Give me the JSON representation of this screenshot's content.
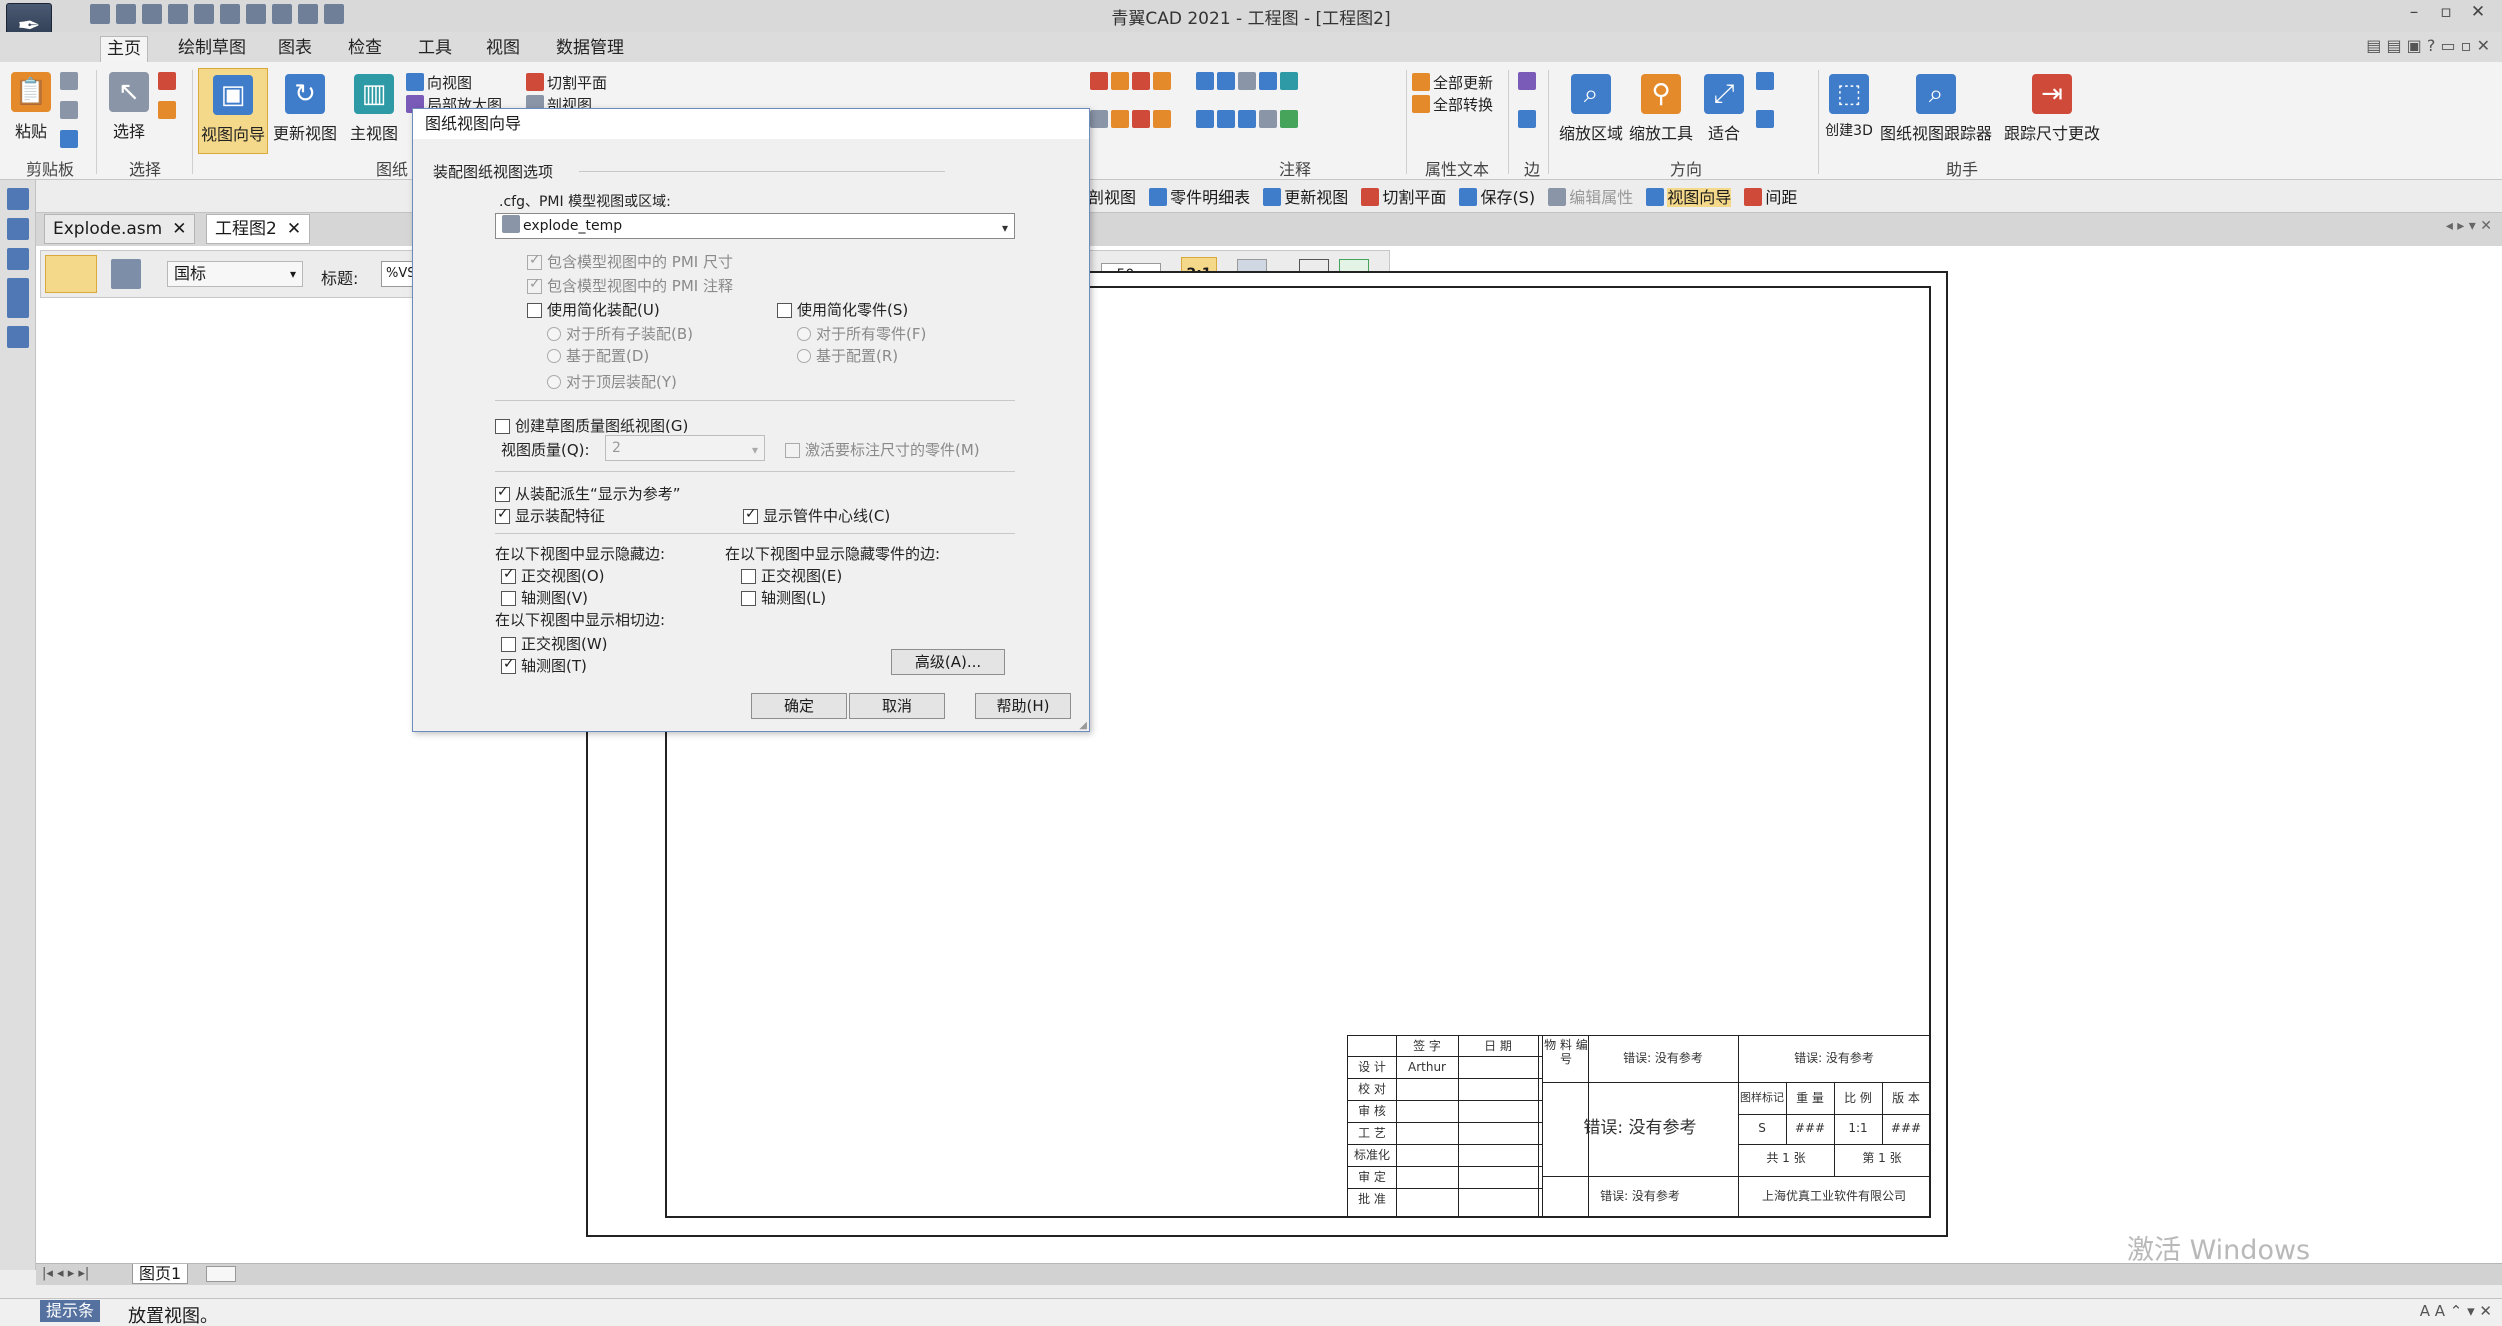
{
  "window": {
    "title": "青翼CAD 2021 - 工程图 - [工程图2]",
    "controls": [
      "–",
      "▫",
      "✕"
    ]
  },
  "ribbon_tabs": [
    "主页",
    "绘制草图",
    "图表",
    "检查",
    "工具",
    "视图",
    "数据管理"
  ],
  "ribbon": {
    "paste": "粘贴",
    "select": "选择",
    "view_wizard": "视图向导",
    "update_view": "更新视图",
    "main_view": "主视图",
    "to_view": "向视图",
    "detail_view": "局部放大图",
    "section_plane": "切割平面",
    "cut_view": "剖视图",
    "update_all": "全部更新",
    "convert_all": "全部转换",
    "zoom_area": "缩放区域",
    "zoom_tool": "缩放工具",
    "fit": "适合",
    "create_3d": "创建3D",
    "view_tracker": "图纸视图跟踪器",
    "track_changes": "跟踪尺寸更改",
    "groups": {
      "clipboard": "剪贴板",
      "select": "选择",
      "drawing_views": "图纸",
      "annotation": "注释",
      "property_text": "属性文本",
      "edge": "边",
      "orientation": "方向",
      "assistant": "助手"
    }
  },
  "cmd_bar": [
    "剖视图",
    "零件明细表",
    "更新视图",
    "切割平面",
    "保存(S)",
    "编辑属性",
    "视图向导",
    "间距"
  ],
  "doc_tabs": [
    {
      "label": "Explode.asm"
    },
    {
      "label": "工程图2"
    }
  ],
  "view_toolbar": {
    "standard": "国标",
    "title_label": "标题:",
    "title_value": "%VSY",
    "scale_value": ".50",
    "scale_btn": "2:1"
  },
  "dialog": {
    "title": "图纸视图向导",
    "section": "装配图纸视图选项",
    "cfg_label": ".cfg、PMI 模型视图或区域:",
    "cfg_value": "explode_temp",
    "pmi_dims": "包含模型视图中的 PMI 尺寸",
    "pmi_notes": "包含模型视图中的 PMI 注释",
    "simp_asm": "使用简化装配(U)",
    "all_sub": "对于所有子装配(B)",
    "by_config": "基于配置(D)",
    "top_asm": "对于顶层装配(Y)",
    "simp_part": "使用简化零件(S)",
    "all_parts": "对于所有零件(F)",
    "by_config2": "基于配置(R)",
    "draft_quality": "创建草图质量图纸视图(G)",
    "view_quality_label": "视图质量(Q):",
    "view_quality_value": "2",
    "activate_dim": "激活要标注尺寸的零件(M)",
    "derive_ref": "从装配派生“显示为参考”",
    "show_features": "显示装配特征",
    "show_centerline": "显示管件中心线(C)",
    "hidden_edges_label": "在以下视图中显示隐藏边:",
    "ortho_o": "正交视图(O)",
    "iso_v": "轴测图(V)",
    "hidden_part_label": "在以下视图中显示隐藏零件的边:",
    "ortho_e": "正交视图(E)",
    "iso_l": "轴测图(L)",
    "tangent_label": "在以下视图中显示相切边:",
    "ortho_w": "正交视图(W)",
    "iso_t": "轴测图(T)",
    "advanced": "高级(A)...",
    "ok": "确定",
    "cancel": "取消",
    "help": "帮助(H)"
  },
  "titleblock": {
    "sign": "签 字",
    "date": "日 期",
    "mat_code": "物 料 编 号",
    "err": "错误: 没有参考",
    "design": "设 计",
    "designer": "Arthur",
    "check": "校 对",
    "review": "审 核",
    "process": "工 艺",
    "std": "标准化",
    "audit": "审 定",
    "approve": "批 准",
    "big_err": "错误: 没有参考",
    "mark": "图样标记",
    "weight": "重 量",
    "scale": "比 例",
    "ver": "版 本",
    "mark_val": "S",
    "weight_val": "###",
    "scale_val": "1:1",
    "ver_val": "###",
    "total": "共 1 张",
    "sheet": "第 1 张",
    "company": "上海优真工业软件有限公司"
  },
  "sheet_tab": "图页1",
  "status": {
    "label": "提示条",
    "text": "放置视图。"
  },
  "watermark": "激活 Windows",
  "colors": {
    "accent": "#f5d98a",
    "dialog_border": "#6b8cbc"
  }
}
